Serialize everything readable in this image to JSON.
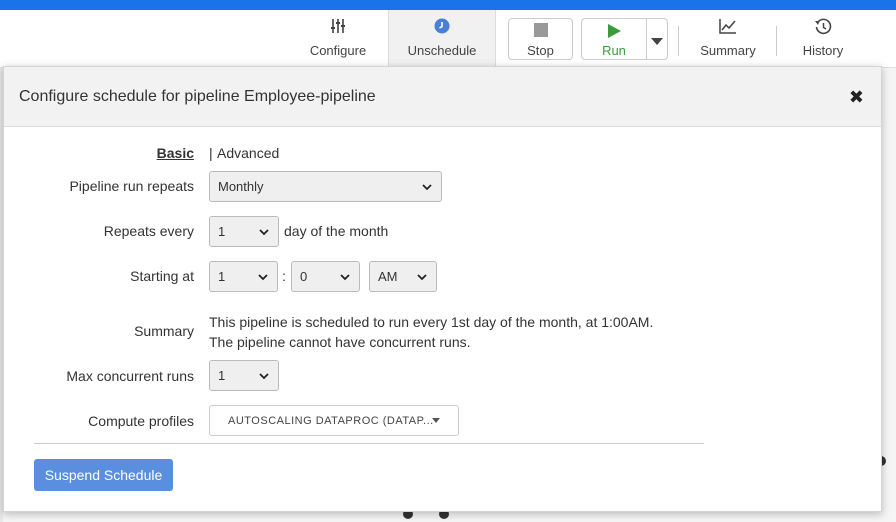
{
  "toolbar": {
    "configure_label": "Configure",
    "unschedule_label": "Unschedule",
    "stop_label": "Stop",
    "run_label": "Run",
    "summary_label": "Summary",
    "history_label": "History"
  },
  "modal": {
    "title": "Configure schedule for pipeline Employee-pipeline",
    "close_glyph": "✖",
    "tabs": {
      "basic": "Basic",
      "separator": "|",
      "advanced": "Advanced"
    },
    "run_repeats": {
      "label": "Pipeline run repeats",
      "value": "Monthly"
    },
    "repeats_every": {
      "label": "Repeats every",
      "value": "1",
      "suffix": "day of the month"
    },
    "starting_at": {
      "label": "Starting at",
      "hour": "1",
      "colon": ":",
      "minute": "0",
      "ampm": "AM"
    },
    "summary": {
      "label": "Summary",
      "line1": "This pipeline is scheduled to run every 1st day of the month, at 1:00AM.",
      "line2": "The pipeline cannot have concurrent runs."
    },
    "max_concurrent": {
      "label": "Max concurrent runs",
      "value": "1"
    },
    "compute_profiles": {
      "label": "Compute profiles",
      "value": "AUTOSCALING DATAPROC (DATAP..."
    },
    "suspend_label": "Suspend Schedule"
  },
  "colors": {
    "top_bar": "#1a73e8",
    "run_green": "#3c9a3c",
    "unschedule_icon": "#4a7fd8",
    "suspend_button": "#5a8fe0"
  }
}
